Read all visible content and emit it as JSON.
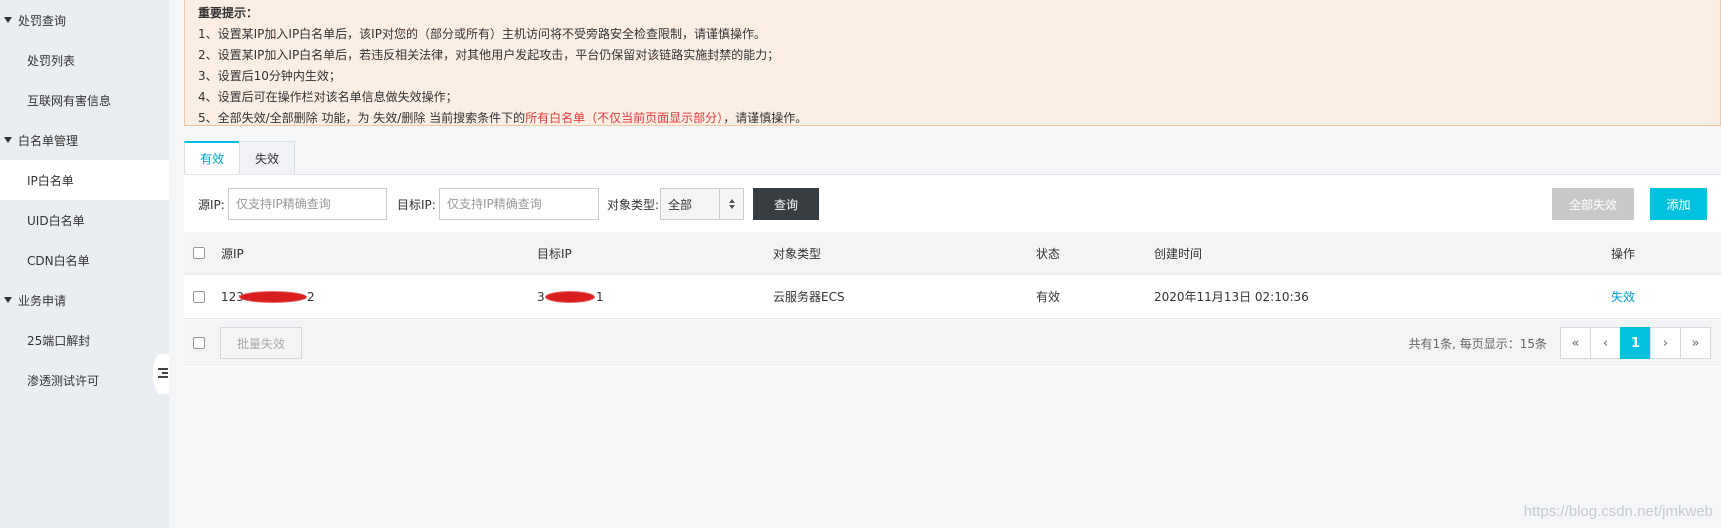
{
  "sidebar": {
    "groups": [
      {
        "label": "处罚查询",
        "items": [
          "处罚列表",
          "互联网有害信息"
        ]
      },
      {
        "label": "白名单管理",
        "items": [
          "IP白名单",
          "UID白名单",
          "CDN白名单"
        ]
      },
      {
        "label": "业务申请",
        "items": [
          "25端口解封",
          "渗透测试许可"
        ]
      }
    ],
    "active_item": "IP白名单"
  },
  "notice": {
    "title": "重要提示：",
    "lines": [
      "1、设置某IP加入IP白名单后，该IP对您的（部分或所有）主机访问将不受旁路安全检查限制，请谨慎操作。",
      "2、设置某IP加入IP白名单后，若违反相关法律，对其他用户发起攻击，平台仍保留对该链路实施封禁的能力；",
      "3、设置后10分钟内生效；",
      "4、设置后可在操作栏对该名单信息做失效操作；"
    ],
    "line5_prefix": "5、全部失效/全部删除 功能，为 失效/删除 当前搜索条件下的",
    "line5_red": "所有白名单（不仅当前页面显示部分）",
    "line5_suffix": "，请谨慎操作。"
  },
  "tabs": [
    {
      "label": "有效",
      "active": true
    },
    {
      "label": "失效",
      "active": false
    }
  ],
  "filters": {
    "source_ip_label": "源IP:",
    "source_ip_placeholder": "仅支持IP精确查询",
    "target_ip_label": "目标IP:",
    "target_ip_placeholder": "仅支持IP精确查询",
    "object_type_label": "对象类型:",
    "object_type_value": "全部",
    "query_button": "查询",
    "disable_all_button": "全部失效",
    "add_button": "添加"
  },
  "table": {
    "columns": [
      "源IP",
      "目标IP",
      "对象类型",
      "状态",
      "创建时间",
      "操作"
    ],
    "rows": [
      {
        "source_ip_start": "123",
        "source_ip_end": "2",
        "target_ip_start": "3",
        "target_ip_end": "1",
        "object_type": "云服务器ECS",
        "status": "有效",
        "created_at": "2020年11月13日 02:10:36",
        "action": "失效"
      }
    ]
  },
  "footer": {
    "batch_button": "批量失效",
    "summary": "共有1条, 每页显示：15条",
    "pager": [
      "«",
      "‹",
      "1",
      "›",
      "»"
    ],
    "current_page": "1"
  },
  "watermark": "https://blog.csdn.net/jmkweb"
}
